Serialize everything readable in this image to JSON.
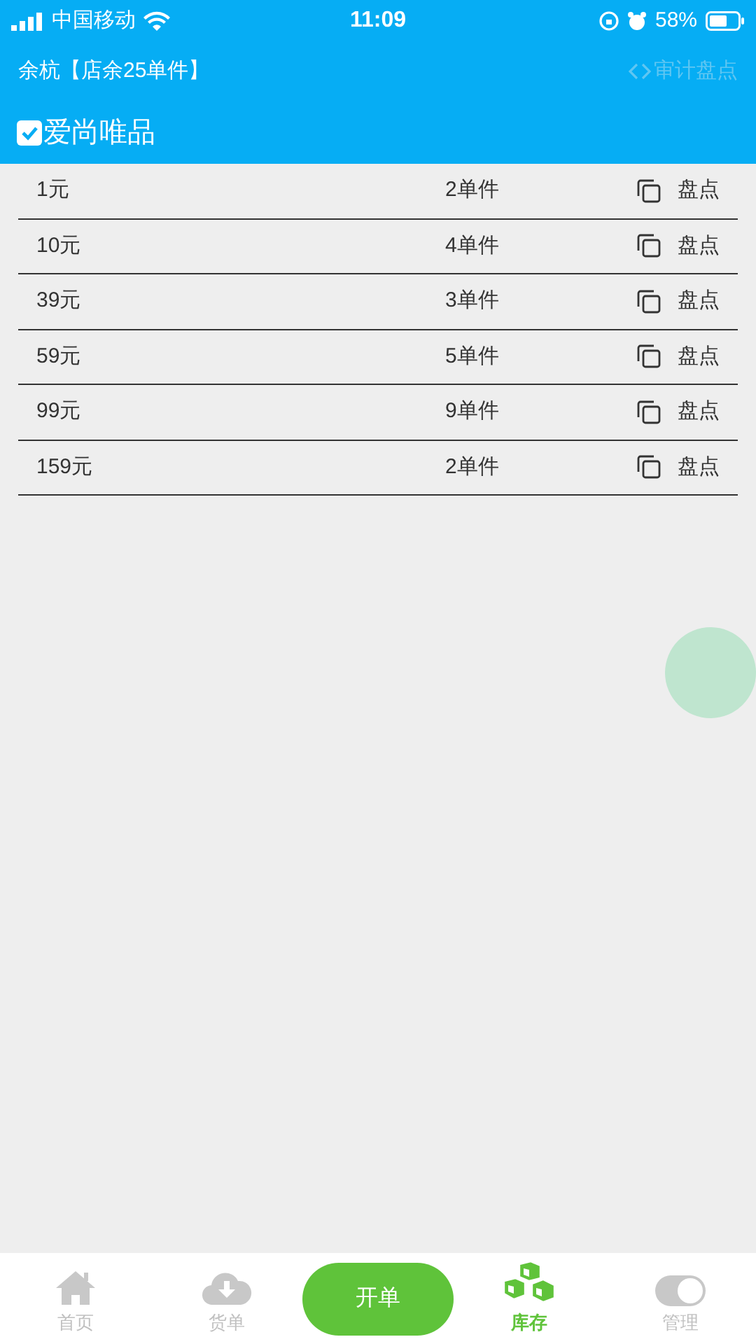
{
  "status_bar": {
    "carrier": "中国移动",
    "time": "11:09",
    "battery": "58%"
  },
  "header": {
    "title": "余杭【店余25单件】",
    "action": {
      "label": "审计盘点",
      "disabled": true
    }
  },
  "category": {
    "label": "爱尚唯品",
    "checked": true
  },
  "rows": [
    {
      "price": "1元",
      "count": "2单件",
      "action": "盘点"
    },
    {
      "price": "10元",
      "count": "4单件",
      "action": "盘点"
    },
    {
      "price": "39元",
      "count": "3单件",
      "action": "盘点"
    },
    {
      "price": "59元",
      "count": "5单件",
      "action": "盘点"
    },
    {
      "price": "99元",
      "count": "9单件",
      "action": "盘点"
    },
    {
      "price": "159元",
      "count": "2单件",
      "action": "盘点"
    }
  ],
  "tabs": [
    {
      "kind": "home",
      "label": "首页",
      "selected": false
    },
    {
      "kind": "download",
      "label": "货单",
      "selected": false
    },
    {
      "kind": "action",
      "label": "开单",
      "selected": false
    },
    {
      "kind": "stock",
      "label": "库存",
      "selected": true
    },
    {
      "kind": "toggle",
      "label": "管理",
      "selected": false
    }
  ]
}
